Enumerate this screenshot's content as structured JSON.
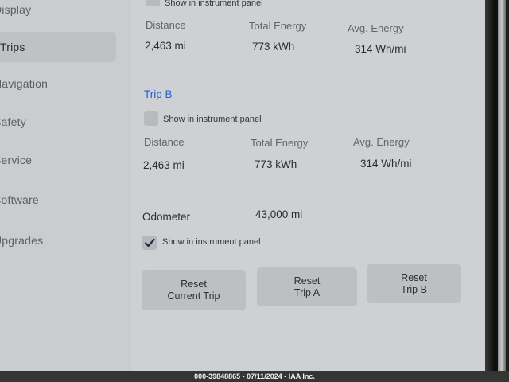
{
  "sidebar": {
    "items": [
      {
        "label": "Display"
      },
      {
        "label": "Trips"
      },
      {
        "label": "Navigation"
      },
      {
        "label": "Safety"
      },
      {
        "label": "Service"
      },
      {
        "label": "Software"
      },
      {
        "label": "Upgrades"
      }
    ]
  },
  "trip_a": {
    "show_label": "Show in instrument panel",
    "headers": {
      "distance": "Distance",
      "total_energy": "Total Energy",
      "avg_energy": "Avg. Energy"
    },
    "values": {
      "distance": "2,463 mi",
      "total_energy": "773 kWh",
      "avg_energy": "314 Wh/mi"
    }
  },
  "trip_b": {
    "title": "Trip B",
    "show_label": "Show in instrument panel",
    "show_checked": false,
    "headers": {
      "distance": "Distance",
      "total_energy": "Total Energy",
      "avg_energy": "Avg. Energy"
    },
    "values": {
      "distance": "2,463 mi",
      "total_energy": "773 kWh",
      "avg_energy": "314 Wh/mi"
    }
  },
  "odometer": {
    "label": "Odometer",
    "value": "43,000 mi",
    "show_label": "Show in instrument panel",
    "show_checked": true
  },
  "buttons": {
    "reset_current": {
      "line1": "Reset",
      "line2": "Current Trip"
    },
    "reset_a": {
      "line1": "Reset",
      "line2": "Trip A"
    },
    "reset_b": {
      "line1": "Reset",
      "line2": "Trip B"
    }
  },
  "footer": {
    "text": "000-39848865 - 07/11/2024 - IAA Inc."
  },
  "colors": {
    "accent": "#1f5fd0",
    "screen_bg": "#cfd0d3",
    "button_bg": "#bdbfc3"
  }
}
